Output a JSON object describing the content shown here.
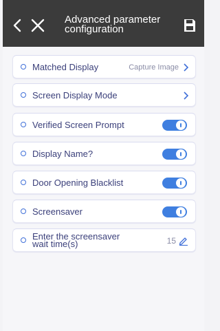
{
  "header": {
    "title_line1": "Advanced parameter",
    "title_line2": "configuration",
    "background_color": "#3b3b3b"
  },
  "icons": {
    "back": "chevron-left-icon",
    "close": "close-icon",
    "save": "save-icon",
    "row_marker": "circle-icon",
    "row_chevron": "chevron-right-icon",
    "edit": "pencil-icon"
  },
  "accent_color": "#3f7fe0",
  "settings": {
    "items": [
      {
        "label": "Matched Display",
        "value": "Capture Image",
        "control": "link"
      },
      {
        "label": "Screen Display Mode",
        "control": "link"
      },
      {
        "label": "Verified Screen Prompt",
        "control": "toggle",
        "on": true
      },
      {
        "label": "Display Name?",
        "control": "toggle",
        "on": true
      },
      {
        "label": "Door Opening Blacklist",
        "control": "toggle",
        "on": true
      },
      {
        "label": "Screensaver",
        "control": "toggle",
        "on": true
      },
      {
        "label_line1": "Enter the screensaver",
        "label_line2": "wait time(s)",
        "value": "15",
        "control": "edit"
      }
    ]
  }
}
